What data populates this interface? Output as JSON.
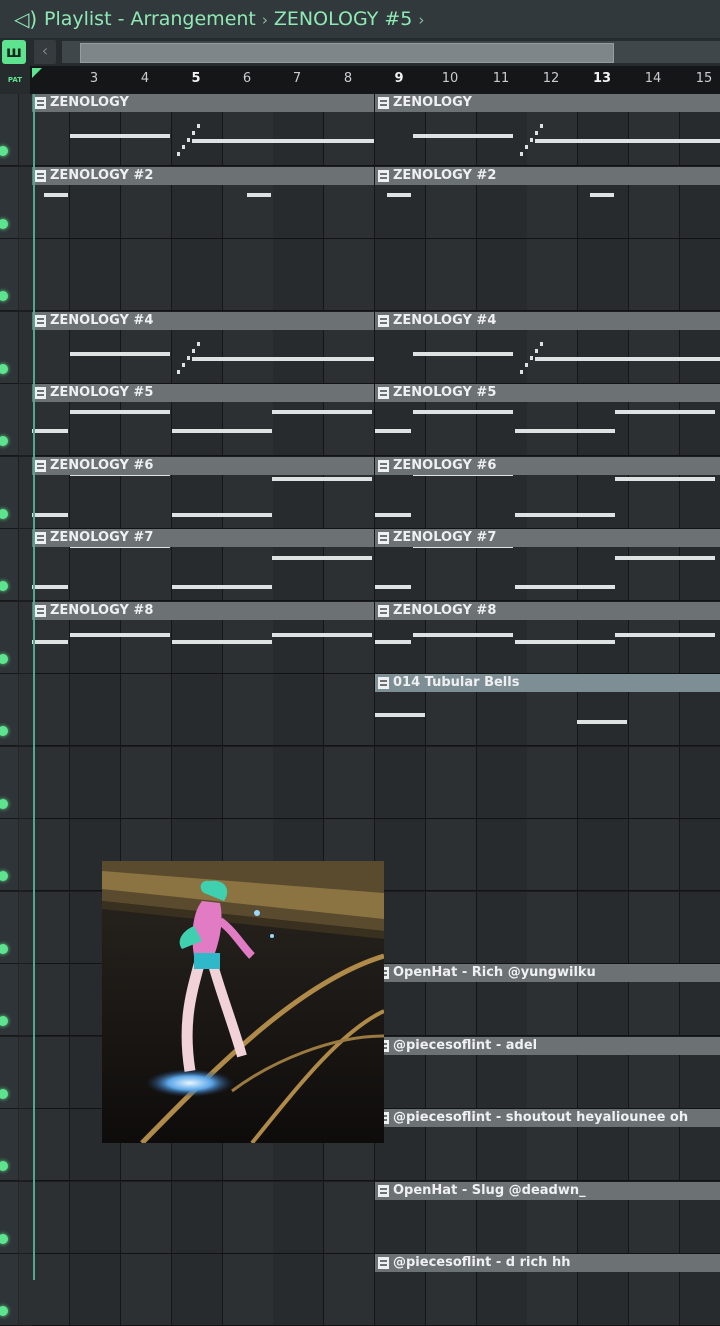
{
  "window": {
    "title_prefix": "Playlist - Arrangement",
    "separator": "›",
    "pattern": "ZENOLOGY #5",
    "end_separator": "›",
    "icon": "speaker-arrows-icon"
  },
  "toolbar": {
    "piano_icon": "piano-roll-icon",
    "back_icon": "chevron-left-icon"
  },
  "ruler": {
    "pat_label": "PAT",
    "numbers": [
      "3",
      "4",
      "5",
      "6",
      "7",
      "8",
      "9",
      "10",
      "11",
      "12",
      "13",
      "14",
      "15"
    ]
  },
  "clips": {
    "z1": "ZENOLOGY",
    "z2": "ZENOLOGY #2",
    "z4": "ZENOLOGY #4",
    "z5": "ZENOLOGY #5",
    "z6": "ZENOLOGY #6",
    "z7": "ZENOLOGY #7",
    "z8": "ZENOLOGY #8",
    "bells": "014 Tubular Bells",
    "a1": "OpenHat - Rich @yungwilku",
    "a2": "@piecesoflint - adel",
    "a3": "@piecesoflint - shoutout heyaliounee oh",
    "a4": "OpenHat - Slug @deadwn_",
    "a5": "@piecesoflint - d rich hh"
  },
  "colors": {
    "accent": "#5ee38f",
    "title": "#8fe9b4",
    "clip_header": "#6c7174"
  }
}
